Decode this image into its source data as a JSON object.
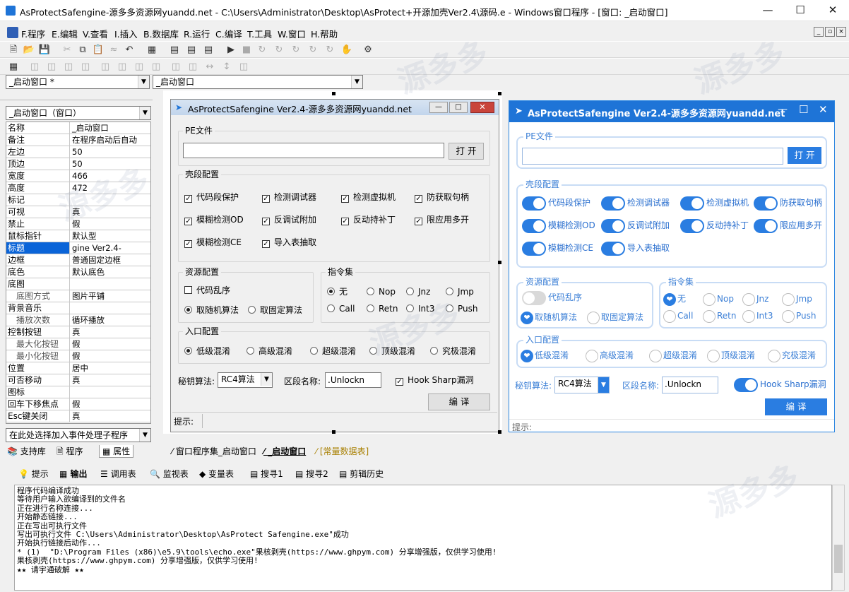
{
  "app": {
    "title": "AsProtectSafengine-源多多资源网yuandd.net - C:\\Users\\Administrator\\Desktop\\AsProtect+开源加壳Ver2.4\\源码.e - Windows窗口程序 - [窗口: _启动窗口]"
  },
  "menu": [
    "F.程序",
    "E.编辑",
    "V.查看",
    "I.插入",
    "B.数据库",
    "R.运行",
    "C.编译",
    "T.工具",
    "W.窗口",
    "H.帮助"
  ],
  "combos": {
    "left": "_启动窗口 *",
    "right": "_启动窗口",
    "object": "_启动窗口（窗口）",
    "event": "在此处选择加入事件处理子程序",
    "rc4": "RC4算法"
  },
  "properties": [
    {
      "name": "名称",
      "value": "_启动窗口"
    },
    {
      "name": "备注",
      "value": "在程序启动后自动"
    },
    {
      "name": "左边",
      "value": "50"
    },
    {
      "name": "顶边",
      "value": "50"
    },
    {
      "name": "宽度",
      "value": "466"
    },
    {
      "name": "高度",
      "value": "472"
    },
    {
      "name": "标记",
      "value": ""
    },
    {
      "name": "可视",
      "value": "真"
    },
    {
      "name": "禁止",
      "value": "假"
    },
    {
      "name": "鼠标指针",
      "value": "默认型"
    },
    {
      "name": "标题",
      "value": "gine Ver2.4-"
    },
    {
      "name": "边框",
      "value": "普通固定边框"
    },
    {
      "name": "底色",
      "value": "默认底色"
    },
    {
      "name": "底图",
      "value": ""
    },
    {
      "name": "底图方式",
      "value": "图片平铺"
    },
    {
      "name": "背景音乐",
      "value": ""
    },
    {
      "name": "播放次数",
      "value": "循环播放"
    },
    {
      "name": "控制按钮",
      "value": "真"
    },
    {
      "name": "最大化按钮",
      "value": "假"
    },
    {
      "name": "最小化按钮",
      "value": "假"
    },
    {
      "name": "位置",
      "value": "居中"
    },
    {
      "name": "可否移动",
      "value": "真"
    },
    {
      "name": "图标",
      "value": ""
    },
    {
      "name": "回车下移焦点",
      "value": "假"
    },
    {
      "name": "Esc键关闭",
      "value": "真"
    }
  ],
  "leftTabs": [
    "支持库",
    "程序",
    "属性"
  ],
  "docTabs": [
    "窗口程序集_启动窗口",
    "_启动窗口",
    "[常量数据表]"
  ],
  "form": {
    "title": "AsProtectSafengine Ver2.4-源多多资源网yuandd.net",
    "pe_label": "PE文件",
    "open_btn": "打 开",
    "shell_label": "壳段配置",
    "shell_opts": [
      "代码段保护",
      "检测调试器",
      "检测虚拟机",
      "防获取句柄",
      "模糊检测OD",
      "反调试附加",
      "反动持补丁",
      "限应用多开",
      "模糊检测CE",
      "导入表抽取"
    ],
    "res_label": "资源配置",
    "res_chk": "代码乱序",
    "res_radios": [
      "取随机算法",
      "取固定算法"
    ],
    "instr_label": "指令集",
    "instr_opts": [
      "无",
      "Nop",
      "Jnz",
      "Jmp",
      "Call",
      "Retn",
      "Int3",
      "Push"
    ],
    "entry_label": "入口配置",
    "entry_opts": [
      "低级混淆",
      "高级混淆",
      "超级混淆",
      "顶级混淆",
      "究极混淆"
    ],
    "key_label": "秘钥算法:",
    "section_label": "区段名称:",
    "section_value": ".Unlockn",
    "hook_label": "Hook Sharp漏洞",
    "compile_btn": "编 译",
    "hint_label": "提示:"
  },
  "outputTabs": [
    "提示",
    "输出",
    "调用表",
    "监视表",
    "变量表",
    "搜寻1",
    "搜寻2",
    "剪辑历史"
  ],
  "output": "程序代码编译成功\n等待用户输入欲编译到的文件名\n正在进行名称连接...\n开始静态链接...\n正在写出可执行文件\n写出可执行文件 C:\\Users\\Administrator\\Desktop\\AsProtect Safengine.exe\"成功\n开始执行链接后动作...\n* (1)  \"D:\\Program Files (x86)\\e5.9\\tools\\echo.exe\"果核剥壳(https://www.ghpym.com) 分享增强版，仅供学习使用!\n果核剥壳(https://www.ghpym.com) 分享增强版，仅供学习使用!\n★★ 请宇通破解 ★★",
  "colors": {
    "accent": "#1e74d7",
    "toggle": "#2a7de1",
    "selection": "#0a64d8"
  }
}
